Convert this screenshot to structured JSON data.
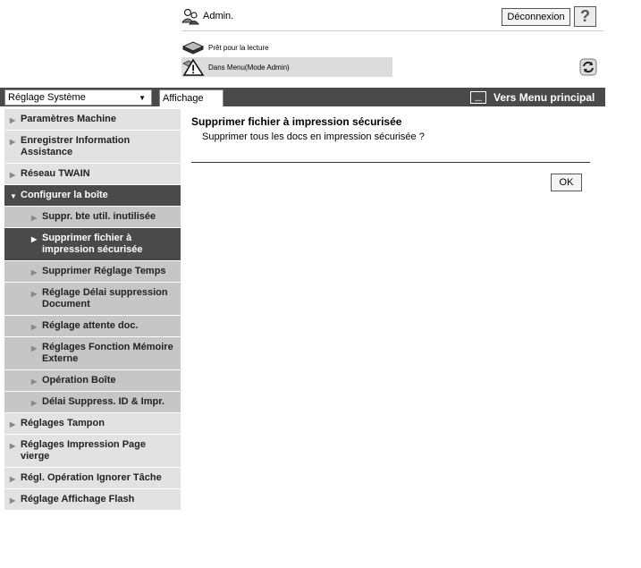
{
  "header": {
    "admin_label": "Admin.",
    "logout_label": "Déconnexion",
    "help_label": "?"
  },
  "status": {
    "ready_text": "Prêt pour la lecture",
    "menu_text": "Dans Menu(Mode Admin)"
  },
  "nav": {
    "system_select_value": "Réglage Système",
    "tab_label": "Affichage",
    "main_menu_label": "Vers Menu principal"
  },
  "sidebar": {
    "items": [
      {
        "label": "Paramètres Machine"
      },
      {
        "label": "Enregistrer Information Assistance"
      },
      {
        "label": "Réseau TWAIN"
      },
      {
        "label": "Configurer la boîte"
      },
      {
        "label": "Suppr. bte util. inutilisée"
      },
      {
        "label": "Supprimer fichier à impression sécurisée"
      },
      {
        "label": "Supprimer Réglage Temps"
      },
      {
        "label": "Réglage Délai suppression Document"
      },
      {
        "label": "Réglage attente doc."
      },
      {
        "label": "Réglages Fonction Mémoire Externe"
      },
      {
        "label": "Opération Boîte"
      },
      {
        "label": "Délai Suppress. ID & Impr."
      },
      {
        "label": "Réglages Tampon"
      },
      {
        "label": "Réglages Impression Page vierge"
      },
      {
        "label": "Régl. Opération Ignorer Tâche"
      },
      {
        "label": "Réglage Affichage Flash"
      }
    ]
  },
  "main": {
    "title": "Supprimer fichier à impression sécurisée",
    "description": "Supprimer tous les docs en impression sécurisée ?",
    "ok_label": "OK"
  },
  "colors": {
    "navbar": "#4a4a4a",
    "sidebar_item": "#e2e2e2",
    "sidebar_sub": "#c6c6c6",
    "active": "#4a4a4a"
  }
}
